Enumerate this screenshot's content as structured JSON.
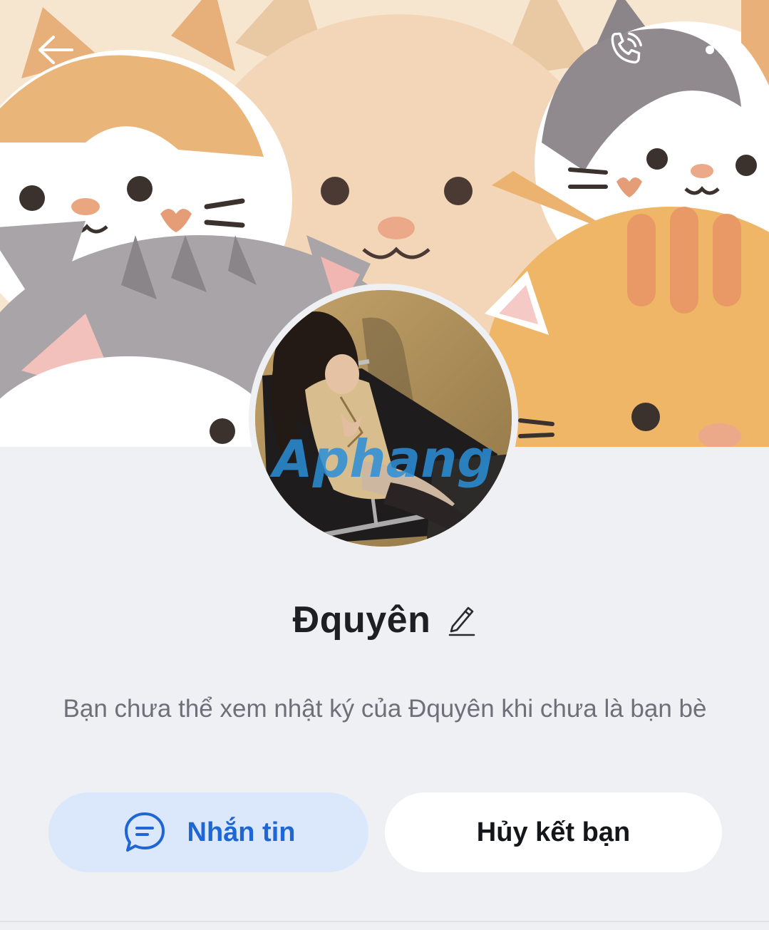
{
  "header": {
    "back_icon": "arrow-left-icon",
    "call_icon": "phone-icon",
    "more_icon": "more-horizontal-icon"
  },
  "profile": {
    "cover_description": "cartoon-cats-cover",
    "avatar_watermark": "Aphang",
    "name": "Đquyên",
    "edit_icon": "pencil-icon"
  },
  "notice": {
    "text": "Bạn chưa thể xem nhật ký của Đquyên khi chưa là bạn bè"
  },
  "actions": {
    "message_label": "Nhắn tin",
    "message_icon": "chat-bubble-icon",
    "unfriend_label": "Hủy kết bạn"
  },
  "colors": {
    "background": "#eff0f4",
    "primary_blue": "#1f66d5",
    "message_button_bg": "#dbe8fb",
    "unfriend_button_bg": "#ffffff",
    "text_dark": "#1e1f24",
    "text_muted": "#6d7079"
  }
}
